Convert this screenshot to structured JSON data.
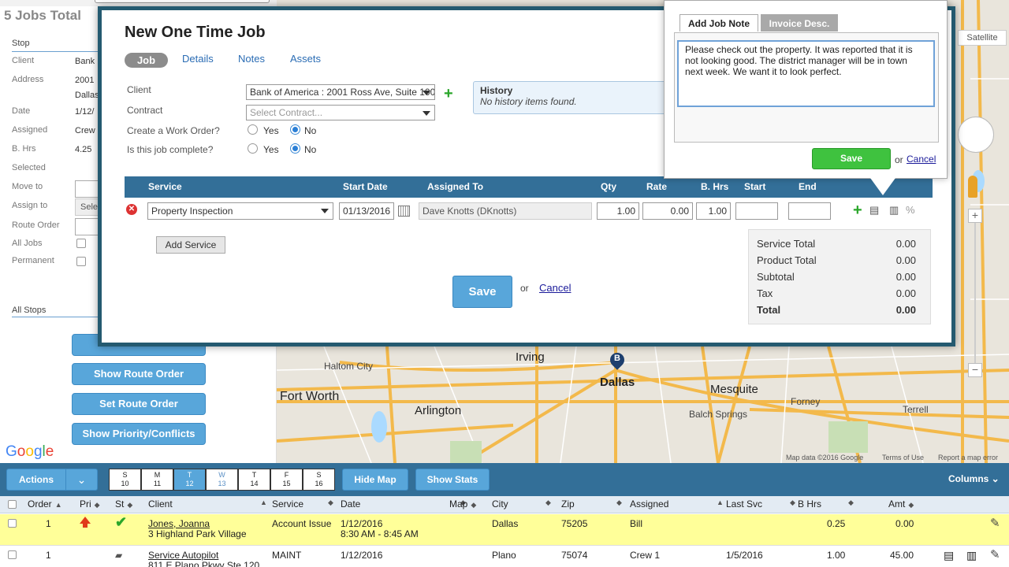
{
  "header": {
    "jobs_total": "5 Jobs Total"
  },
  "left_panel": {
    "stop_label": "Stop",
    "fields": [
      {
        "label": "Client",
        "value": "Bank"
      },
      {
        "label": "Address",
        "value": "2001",
        "value2": "Dallas"
      },
      {
        "label": "Date",
        "value": "1/12/"
      },
      {
        "label": "Assigned",
        "value": "Crew"
      },
      {
        "label": "B. Hrs",
        "value": "4.25"
      },
      {
        "label": "Selected",
        "value": ""
      },
      {
        "label": "Move to",
        "value": ""
      },
      {
        "label": "Assign to",
        "value": "Sele"
      },
      {
        "label": "Route Order",
        "value": ""
      },
      {
        "label": "All Jobs",
        "value": ""
      },
      {
        "label": "Permanent",
        "value": ""
      }
    ],
    "all_stops": "All Stops",
    "buttons": {
      "show_route": "Show Route Order",
      "set_route": "Set Route Order",
      "show_priority": "Show Priority/Conflicts"
    }
  },
  "google_logo": "Google",
  "map": {
    "satellite": "Satellite",
    "labels": [
      "Haltom City",
      "Irving",
      "Dallas",
      "Mesquite",
      "Fort Worth",
      "Arlington",
      "Balch Springs",
      "Forney",
      "Terrell"
    ],
    "marker": "B",
    "footer": {
      "data": "Map data ©2016 Google",
      "terms": "Terms of Use",
      "report": "Report a map error"
    }
  },
  "modal": {
    "title": "New One Time Job",
    "tabs": [
      "Job",
      "Details",
      "Notes",
      "Assets"
    ],
    "client_label": "Client",
    "client_value": "Bank of America : 2001 Ross Ave, Suite 100",
    "contract_label": "Contract",
    "contract_placeholder": "Select Contract...",
    "work_order_label": "Create a Work Order?",
    "complete_label": "Is this job complete?",
    "yes": "Yes",
    "no": "No",
    "history_title": "History",
    "history_text": "No history items found.",
    "service_columns": [
      "Service",
      "Start Date",
      "Assigned To",
      "Qty",
      "Rate",
      "B. Hrs",
      "Start",
      "End"
    ],
    "service_row": {
      "service": "Property Inspection",
      "start_date": "01/13/2016",
      "assigned_to": "Dave Knotts (DKnotts)",
      "qty": "1.00",
      "rate": "0.00",
      "b_hrs": "1.00",
      "start": "",
      "end": ""
    },
    "add_service": "Add Service",
    "totals": [
      {
        "label": "Service Total",
        "value": "0.00"
      },
      {
        "label": "Product Total",
        "value": "0.00"
      },
      {
        "label": "Subtotal",
        "value": "0.00"
      },
      {
        "label": "Tax",
        "value": "0.00"
      },
      {
        "label": "Total",
        "value": "0.00"
      }
    ],
    "save": "Save",
    "or": "or",
    "cancel": "Cancel"
  },
  "note_popup": {
    "tab_active": "Add Job Note",
    "tab_inactive": "Invoice Desc.",
    "text": "Please check out the property.  It was reported that it is not looking good.  The district manager will be in town next week.  We want it to look perfect.",
    "save": "Save",
    "or": "or",
    "cancel": "Cancel"
  },
  "toolbar": {
    "actions": "Actions",
    "days": [
      {
        "d": "S",
        "n": "10"
      },
      {
        "d": "M",
        "n": "11"
      },
      {
        "d": "T",
        "n": "12"
      },
      {
        "d": "W",
        "n": "13"
      },
      {
        "d": "T",
        "n": "14"
      },
      {
        "d": "F",
        "n": "15"
      },
      {
        "d": "S",
        "n": "16"
      }
    ],
    "hide_map": "Hide Map",
    "show_stats": "Show Stats",
    "columns": "Columns"
  },
  "table": {
    "headers": [
      "Order",
      "Pri",
      "St",
      "Client",
      "Service",
      "Date",
      "Map",
      "City",
      "Zip",
      "Assigned",
      "Last Svc",
      "B Hrs",
      "Amt"
    ],
    "rows": [
      {
        "order": "1",
        "client": "Jones, Joanna",
        "client2": "3 Highland Park Village",
        "service": "Account Issue",
        "date": "1/12/2016",
        "date2": "8:30 AM - 8:45 AM",
        "city": "Dallas",
        "zip": "75205",
        "assigned": "Bill",
        "last_svc": "",
        "b_hrs": "0.25",
        "amt": "0.00"
      },
      {
        "order": "1",
        "client": "Service Autopilot",
        "client2": "811 E Plano Pkwy Ste 120",
        "service": "MAINT",
        "date": "1/12/2016",
        "date2": "",
        "city": "Plano",
        "zip": "75074",
        "assigned": "Crew 1",
        "last_svc": "1/5/2016",
        "b_hrs": "1.00",
        "amt": "45.00"
      }
    ]
  }
}
